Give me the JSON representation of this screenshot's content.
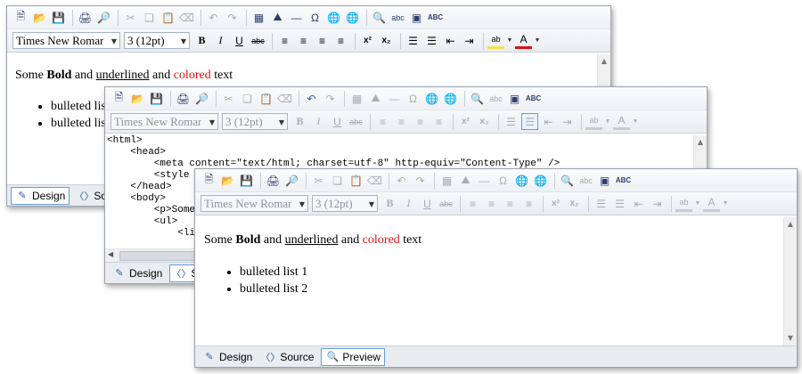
{
  "toolbar": {
    "font_name": "Times New Romar",
    "font_size": "3 (12pt)",
    "icons": {
      "new": "new-document-icon",
      "open": "open-folder-icon",
      "save": "save-icon",
      "print": "print-icon",
      "print_preview": "print-preview-icon",
      "cut": "cut-icon",
      "copy": "copy-icon",
      "paste": "paste-icon",
      "clear": "eraser-icon",
      "undo": "undo-icon",
      "redo": "redo-icon",
      "table": "insert-table-icon",
      "image": "insert-image-icon",
      "hr": "horizontal-rule-icon",
      "symbol": "omega-symbol-icon",
      "link": "insert-link-icon",
      "unlink": "remove-link-icon",
      "find": "find-icon",
      "replace": "find-replace-icon",
      "select_all": "select-all-icon",
      "spell": "spell-check-icon",
      "bold": "bold-icon",
      "italic": "italic-icon",
      "underline": "underline-icon",
      "strike": "strikethrough-icon",
      "align_left": "align-left-icon",
      "align_center": "align-center-icon",
      "align_right": "align-right-icon",
      "justify": "justify-icon",
      "superscript": "superscript-icon",
      "subscript": "subscript-icon",
      "ordered_list": "ordered-list-icon",
      "bullet_list": "bullet-list-icon",
      "outdent": "outdent-icon",
      "indent": "indent-icon",
      "highlight": "highlight-color-icon",
      "font_color": "font-color-icon"
    },
    "glyphs": {
      "bold": "B",
      "italic": "I",
      "underline": "U",
      "strike": "abc",
      "superscript": "x²",
      "subscript": "x₂",
      "symbol": "Ω",
      "hr": "—",
      "spell": "ABC",
      "replace": "abc",
      "font_color": "A",
      "highlight": "ab"
    }
  },
  "document": {
    "text_before_bold": "Some ",
    "bold": "Bold",
    "text_and1": " and ",
    "underlined": "underlined",
    "text_and2": " and ",
    "colored": "colored",
    "text_end": " text",
    "bullets": [
      "bulleted list 1",
      "bulleted list 2"
    ],
    "colored_color": "#e01010"
  },
  "source": {
    "lines": [
      "<html>",
      "    <head>",
      "        <meta content=\"text/html; charset=utf-8\" http-equiv=\"Content-Type\" />",
      "        <style",
      "    </head>",
      "    <body>",
      "        <p>Some",
      "        <ul>",
      "            <li"
    ]
  },
  "modes": {
    "design": "Design",
    "source": "Source",
    "source_truncated": "Sou",
    "source_truncated2": "So",
    "preview": "Preview"
  },
  "colors": {
    "accent": "#6a9bd6",
    "icon": "#2a3f6b",
    "disabled": "#a8adb6",
    "font_color_bar": "#e01010",
    "highlight_bar": "#f2e24a"
  }
}
